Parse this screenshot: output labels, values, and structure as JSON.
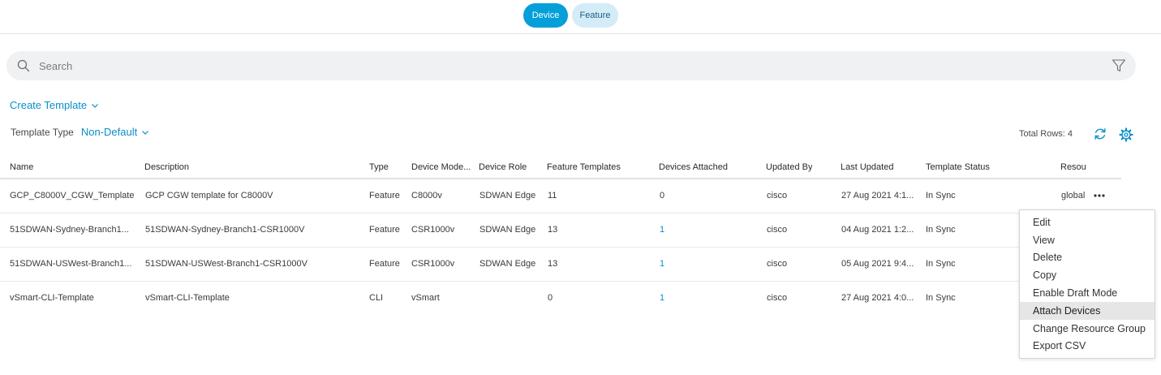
{
  "toggle": {
    "device_label": "Device",
    "feature_label": "Feature"
  },
  "search": {
    "placeholder": "Search",
    "value": ""
  },
  "create_template": {
    "label": "Create Template"
  },
  "template_type": {
    "label": "Template Type",
    "selected": "Non-Default"
  },
  "total_rows": "Total Rows: 4",
  "colors": {
    "accent": "#049fd9",
    "link": "#0a8fc7",
    "toggle_inactive": "#d3ecf8",
    "menu_hover": "#e6e6e6"
  },
  "icons": [
    "search-icon",
    "filter-icon",
    "chevron-down-icon",
    "refresh-icon",
    "gear-icon",
    "more-horizontal-icon"
  ],
  "table": {
    "headers": [
      "Name",
      "Description",
      "Type",
      "Device Mode...",
      "Device Role",
      "Feature Templates",
      "Devices Attached",
      "Updated By",
      "Last Updated",
      "Template Status",
      "Resou"
    ],
    "rows": [
      [
        "GCP_C8000V_CGW_Template",
        "GCP CGW template for C8000V",
        "Feature",
        "C8000v",
        "SDWAN Edge",
        "11",
        "0",
        "cisco",
        "27 Aug 2021 4:1...",
        "In Sync",
        "global"
      ],
      [
        "51SDWAN-Sydney-Branch1...",
        "51SDWAN-Sydney-Branch1-CSR1000V",
        "Feature",
        "CSR1000v",
        "SDWAN Edge",
        "13",
        "1",
        "cisco",
        "04 Aug 2021 1:2...",
        "In Sync",
        ""
      ],
      [
        "51SDWAN-USWest-Branch1...",
        "51SDWAN-USWest-Branch1-CSR1000V",
        "Feature",
        "CSR1000v",
        "SDWAN Edge",
        "13",
        "1",
        "cisco",
        "05 Aug 2021 9:4...",
        "In Sync",
        ""
      ],
      [
        "vSmart-CLI-Template",
        "vSmart-CLI-Template",
        "CLI",
        "vSmart",
        "",
        "0",
        "1",
        "cisco",
        "27 Aug 2021 4:0...",
        "In Sync",
        ""
      ]
    ]
  },
  "context_menu": {
    "items": [
      "Edit",
      "View",
      "Delete",
      "Copy",
      "Enable Draft Mode",
      "Attach Devices",
      "Change Resource Group",
      "Export CSV"
    ],
    "highlighted": "Attach Devices"
  }
}
